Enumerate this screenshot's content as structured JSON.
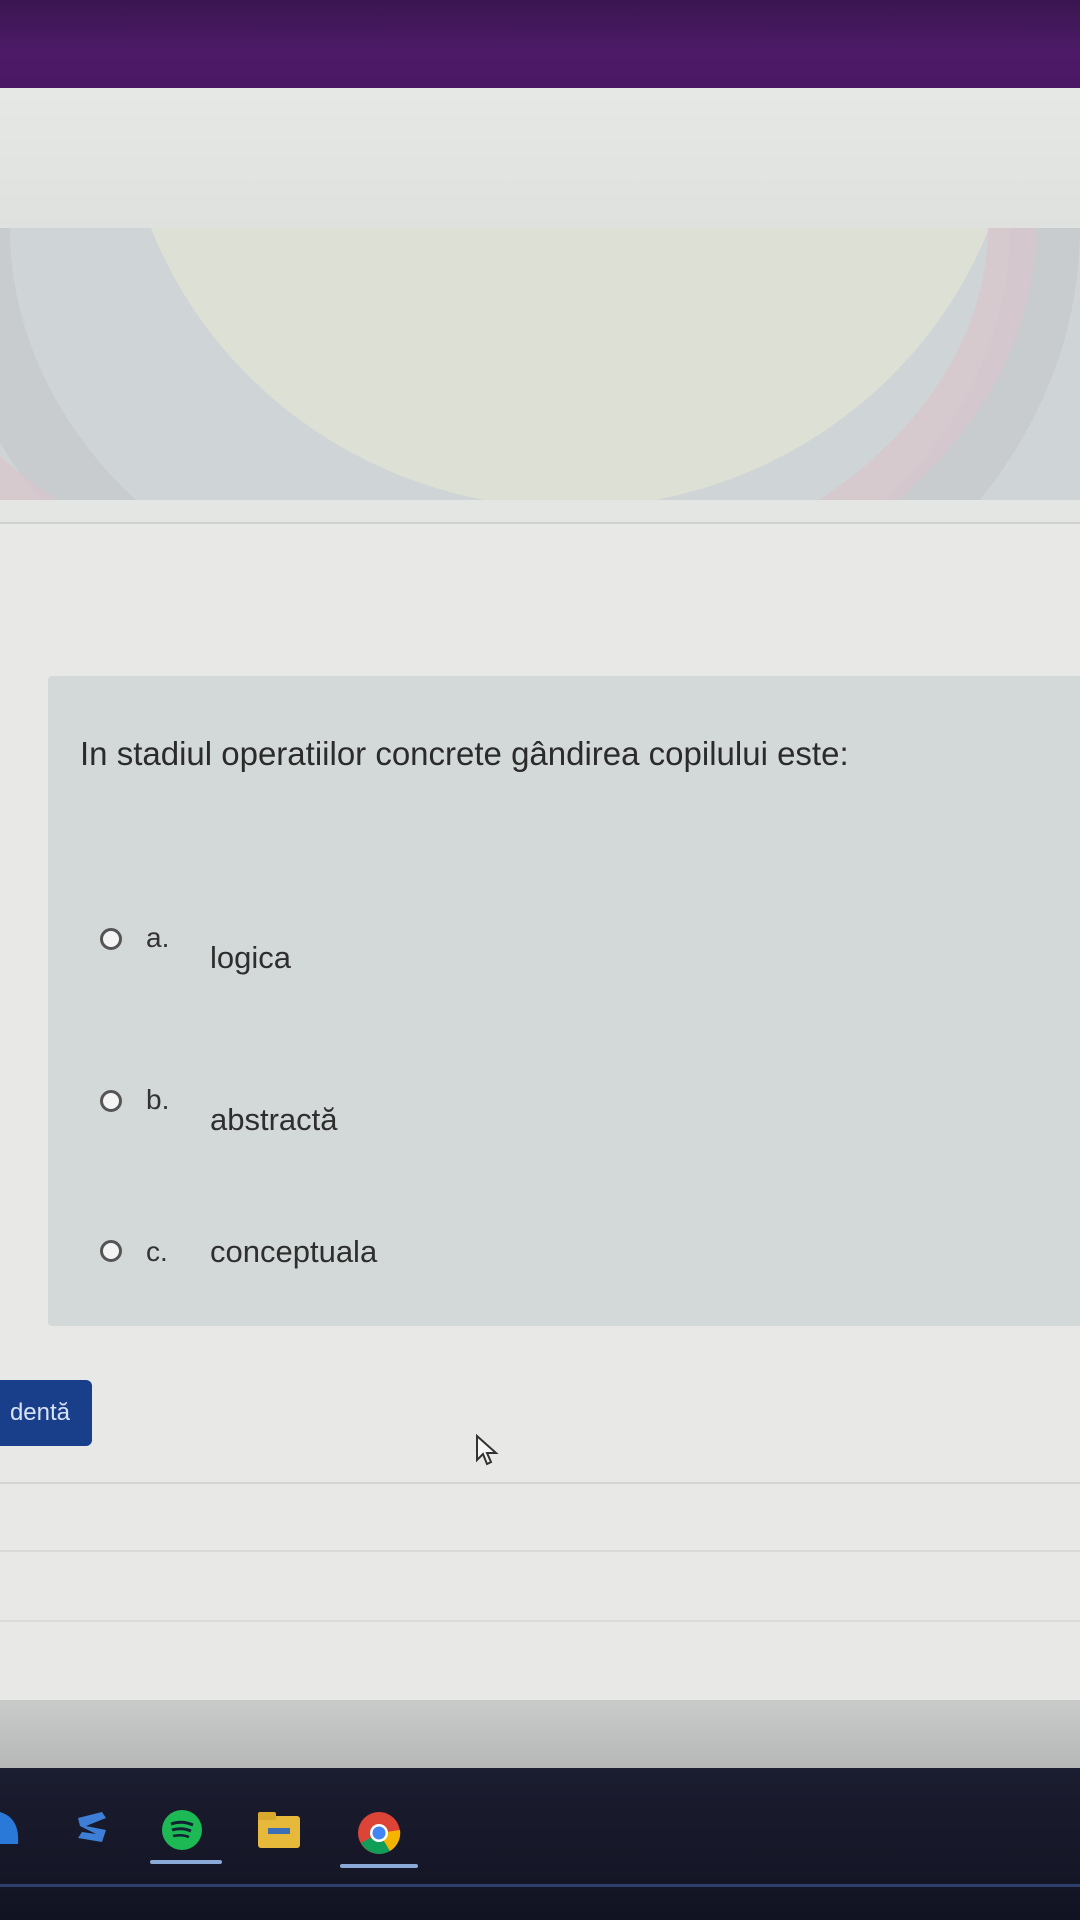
{
  "question": {
    "text": "In stadiul operatiilor concrete gândirea copilului este:",
    "options": [
      {
        "letter": "a.",
        "text": "logica"
      },
      {
        "letter": "b.",
        "text": "abstractă"
      },
      {
        "letter": "c.",
        "text": "conceptuala"
      }
    ]
  },
  "navigation": {
    "previous_label": "dentă"
  },
  "taskbar": {
    "icons": [
      "edge-icon",
      "app-icon",
      "spotify-icon",
      "file-explorer-icon",
      "chrome-icon"
    ]
  },
  "colors": {
    "header": "#4c1a66",
    "question_box": "#d3d9d8",
    "button": "#1a3f8a",
    "taskbar": "#1b1d30"
  }
}
